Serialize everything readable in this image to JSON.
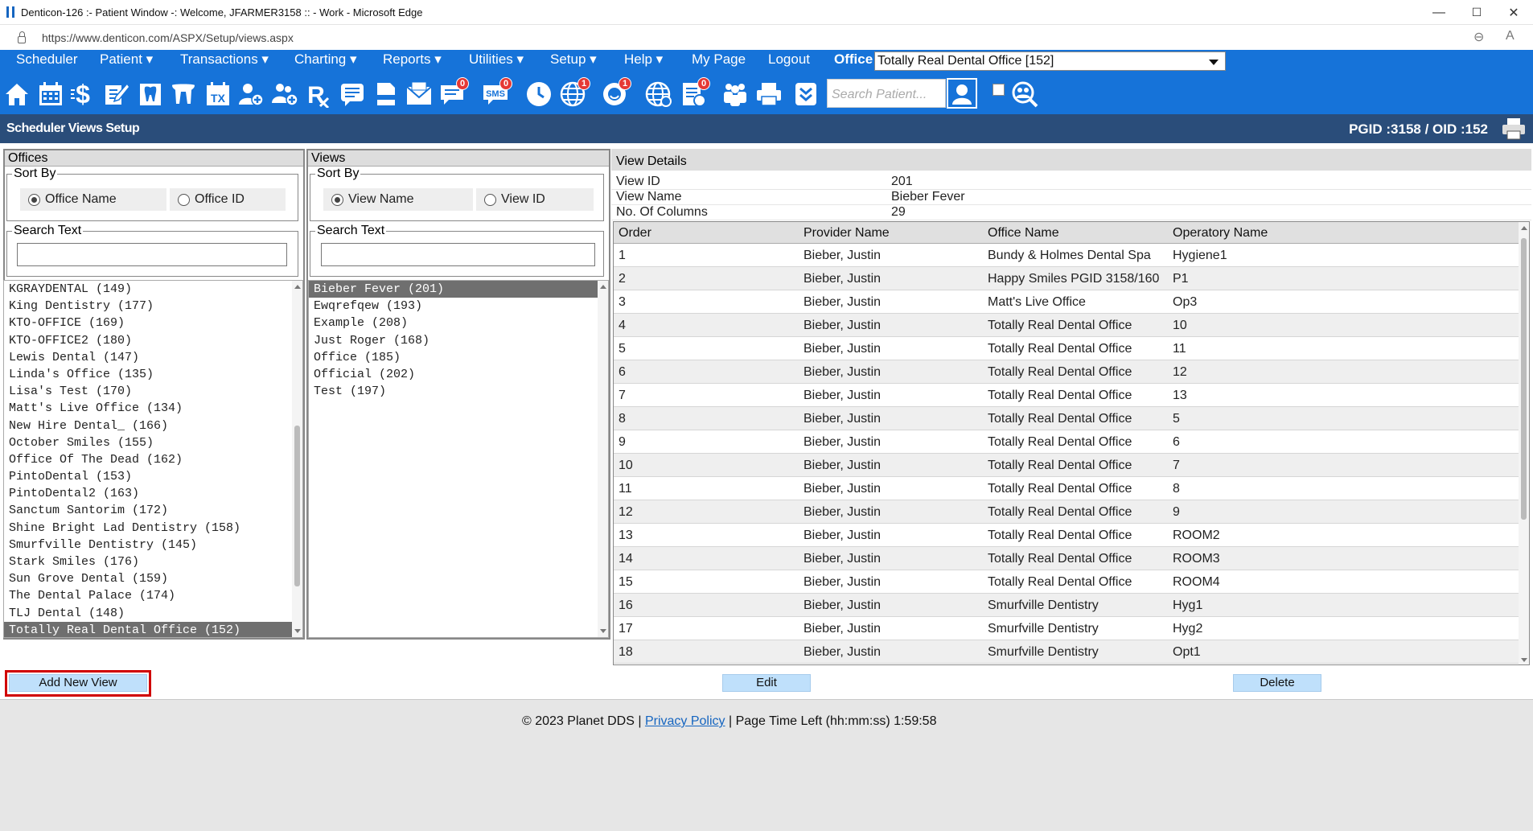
{
  "browser": {
    "title": "Denticon-126 :- Patient Window -: Welcome, JFARMER3158 :: - Work - Microsoft Edge",
    "url": "https://www.denticon.com/ASPX/Setup/views.aspx",
    "minimize": "—",
    "maximize": "☐",
    "close": "✕"
  },
  "menu": {
    "items": [
      "Scheduler",
      "Patient ▾",
      "Transactions ▾",
      "Charting ▾",
      "Reports ▾",
      "Utilities ▾",
      "Setup ▾",
      "Help ▾",
      "My Page",
      "Logout"
    ],
    "office_label": "Office",
    "office_value": "Totally Real Dental Office [152]"
  },
  "toolbar": {
    "icons": [
      "home-icon",
      "calendar-icon",
      "dollar-icon",
      "edit-chart-icon",
      "tooth-icon",
      "teeth-icon",
      "tx-plan-icon",
      "add-patient-icon",
      "add-family-icon",
      "rx-icon",
      "notes-icon",
      "document-icon",
      "mail-icon",
      "message-icon",
      "sms-icon",
      "clock-icon",
      "globe-alert-icon",
      "support-icon",
      "web-icon",
      "report-icon",
      "people-icon",
      "printer-icon",
      "checklist-icon"
    ],
    "badges": {
      "message": "0",
      "sms": "0",
      "globe": "1",
      "support": "1",
      "report": "0"
    },
    "sms_text": "SMS",
    "tx_text": "TX",
    "search_placeholder": "Search Patient...",
    "accent": "#1673d9"
  },
  "header": {
    "title": "Scheduler Views Setup",
    "ids": "PGID :3158  /  OID :152"
  },
  "offices": {
    "title": "Offices",
    "sort_by": "Sort By",
    "sort_options": [
      "Office Name",
      "Office ID"
    ],
    "sort_selected": 0,
    "search_label": "Search Text",
    "search_value": "",
    "items": [
      "KGRAYDENTAL (149)",
      "King Dentistry (177)",
      "KTO-OFFICE (169)",
      "KTO-OFFICE2 (180)",
      "Lewis Dental (147)",
      "Linda's Office (135)",
      "Lisa's Test (170)",
      "Matt's Live Office (134)",
      "New Hire Dental_ (166)",
      "October Smiles (155)",
      "Office Of The Dead (162)",
      "PintoDental (153)",
      "PintoDental2 (163)",
      "Sanctum Santorim (172)",
      "Shine Bright Lad Dentistry (158)",
      "Smurfville Dentistry (145)",
      "Stark Smiles (176)",
      "Sun Grove Dental (159)",
      "The Dental Palace (174)",
      "TLJ Dental (148)",
      "Totally Real Dental Office (152)"
    ],
    "selected": 20
  },
  "views": {
    "title": "Views",
    "sort_by": "Sort By",
    "sort_options": [
      "View Name",
      "View ID"
    ],
    "sort_selected": 0,
    "search_label": "Search Text",
    "search_value": "",
    "items": [
      "Bieber Fever (201)",
      "Ewqrefqew (193)",
      "Example (208)",
      "Just Roger (168)",
      "Office (185)",
      "Official (202)",
      "Test (197)"
    ],
    "selected": 0
  },
  "details": {
    "title": "View Details",
    "fields": [
      {
        "label": "View ID",
        "value": "201"
      },
      {
        "label": "View Name",
        "value": "Bieber Fever"
      },
      {
        "label": "No. Of Columns",
        "value": "29"
      }
    ],
    "columns": [
      "Order",
      "Provider Name",
      "Office Name",
      "Operatory Name"
    ],
    "rows": [
      [
        "1",
        "Bieber, Justin",
        "Bundy & Holmes Dental Spa",
        "Hygiene1"
      ],
      [
        "2",
        "Bieber, Justin",
        "Happy Smiles PGID 3158/160",
        "P1"
      ],
      [
        "3",
        "Bieber, Justin",
        "Matt's Live Office",
        "Op3"
      ],
      [
        "4",
        "Bieber, Justin",
        "Totally Real Dental Office",
        "10"
      ],
      [
        "5",
        "Bieber, Justin",
        "Totally Real Dental Office",
        "11"
      ],
      [
        "6",
        "Bieber, Justin",
        "Totally Real Dental Office",
        "12"
      ],
      [
        "7",
        "Bieber, Justin",
        "Totally Real Dental Office",
        "13"
      ],
      [
        "8",
        "Bieber, Justin",
        "Totally Real Dental Office",
        "5"
      ],
      [
        "9",
        "Bieber, Justin",
        "Totally Real Dental Office",
        "6"
      ],
      [
        "10",
        "Bieber, Justin",
        "Totally Real Dental Office",
        "7"
      ],
      [
        "11",
        "Bieber, Justin",
        "Totally Real Dental Office",
        "8"
      ],
      [
        "12",
        "Bieber, Justin",
        "Totally Real Dental Office",
        "9"
      ],
      [
        "13",
        "Bieber, Justin",
        "Totally Real Dental Office",
        "ROOM2"
      ],
      [
        "14",
        "Bieber, Justin",
        "Totally Real Dental Office",
        "ROOM3"
      ],
      [
        "15",
        "Bieber, Justin",
        "Totally Real Dental Office",
        "ROOM4"
      ],
      [
        "16",
        "Bieber, Justin",
        "Smurfville Dentistry",
        "Hyg1"
      ],
      [
        "17",
        "Bieber, Justin",
        "Smurfville Dentistry",
        "Hyg2"
      ],
      [
        "18",
        "Bieber, Justin",
        "Smurfville Dentistry",
        "Opt1"
      ]
    ]
  },
  "actions": {
    "add": "Add New View",
    "edit": "Edit",
    "delete": "Delete",
    "highlight_color": "#d00000"
  },
  "footer": {
    "copyright": "© 2023 Planet DDS",
    "sep1": "|",
    "privacy": "Privacy Policy",
    "sep2": "|",
    "time_left": "Page Time Left (hh:mm:ss) 1:59:58"
  }
}
